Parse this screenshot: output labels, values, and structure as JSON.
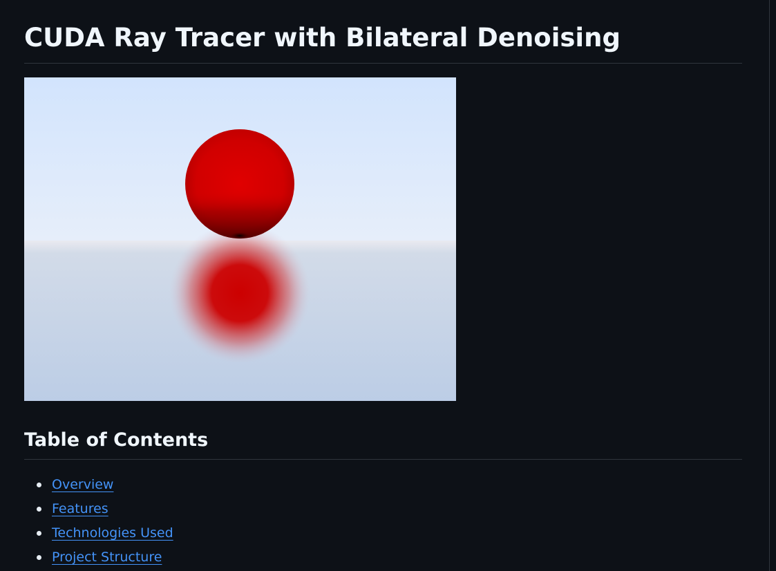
{
  "document": {
    "title": "CUDA Ray Tracer with Bilateral Denoising",
    "toc_heading": "Table of Contents",
    "toc_items": [
      {
        "label": "Overview"
      },
      {
        "label": "Features"
      },
      {
        "label": "Technologies Used"
      },
      {
        "label": "Project Structure"
      }
    ]
  },
  "colors": {
    "background": "#0d1117",
    "heading": "#f0f6fc",
    "link": "#4493f8",
    "divider": "#30363d",
    "sphere": "#dd0000",
    "sky_top": "#d2e4fd",
    "ground": "#c0d0e8"
  }
}
